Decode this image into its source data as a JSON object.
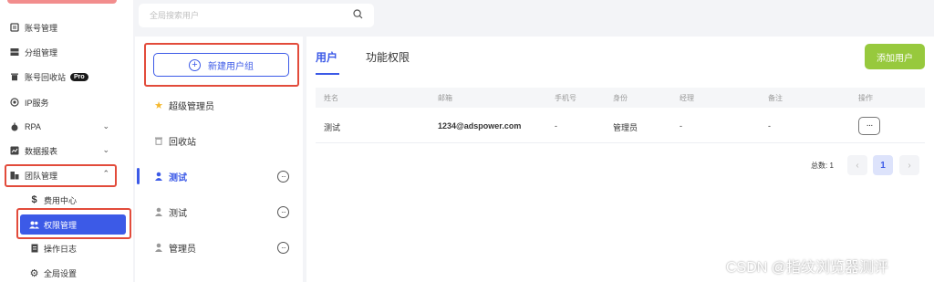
{
  "sidebar": {
    "items": [
      {
        "label": "账号管理",
        "icon": "account-icon"
      },
      {
        "label": "分组管理",
        "icon": "group-icon"
      },
      {
        "label": "账号回收站",
        "icon": "trash-icon",
        "badge": "Pro"
      },
      {
        "label": "IP服务",
        "icon": "ip-icon"
      },
      {
        "label": "RPA",
        "icon": "robot-icon"
      },
      {
        "label": "数据报表",
        "icon": "chart-icon"
      },
      {
        "label": "团队管理",
        "icon": "team-icon"
      }
    ],
    "sub_items": [
      {
        "label": "费用中心",
        "icon": "dollar-icon"
      },
      {
        "label": "权限管理",
        "icon": "users-icon"
      },
      {
        "label": "操作日志",
        "icon": "log-icon"
      },
      {
        "label": "全局设置",
        "icon": "gear-icon"
      }
    ]
  },
  "search": {
    "placeholder": "全局搜索用户"
  },
  "groups": {
    "new_button": "新建用户组",
    "list": [
      {
        "label": "超级管理员",
        "icon": "star-icon"
      },
      {
        "label": "回收站",
        "icon": "trash-icon"
      },
      {
        "label": "测试",
        "icon": "user-icon"
      },
      {
        "label": "测试",
        "icon": "user-icon"
      },
      {
        "label": "管理员",
        "icon": "user-icon"
      }
    ]
  },
  "tabs": [
    "用户",
    "功能权限"
  ],
  "add_user_button": "添加用户",
  "table": {
    "headers": [
      "姓名",
      "邮箱",
      "手机号",
      "身份",
      "经理",
      "备注",
      "操作"
    ],
    "rows": [
      [
        "测试",
        "1234@adspower.com",
        "-",
        "管理员",
        "-",
        "-"
      ]
    ]
  },
  "pagination": {
    "total_label": "总数: 1",
    "current_page": "1",
    "prev": "‹",
    "next": "›"
  },
  "watermark": "CSDN @指纹浏览器测评",
  "colors": {
    "accent": "#3c5ae7",
    "add_button": "#97c93d",
    "highlight_box": "#e24b3b"
  }
}
